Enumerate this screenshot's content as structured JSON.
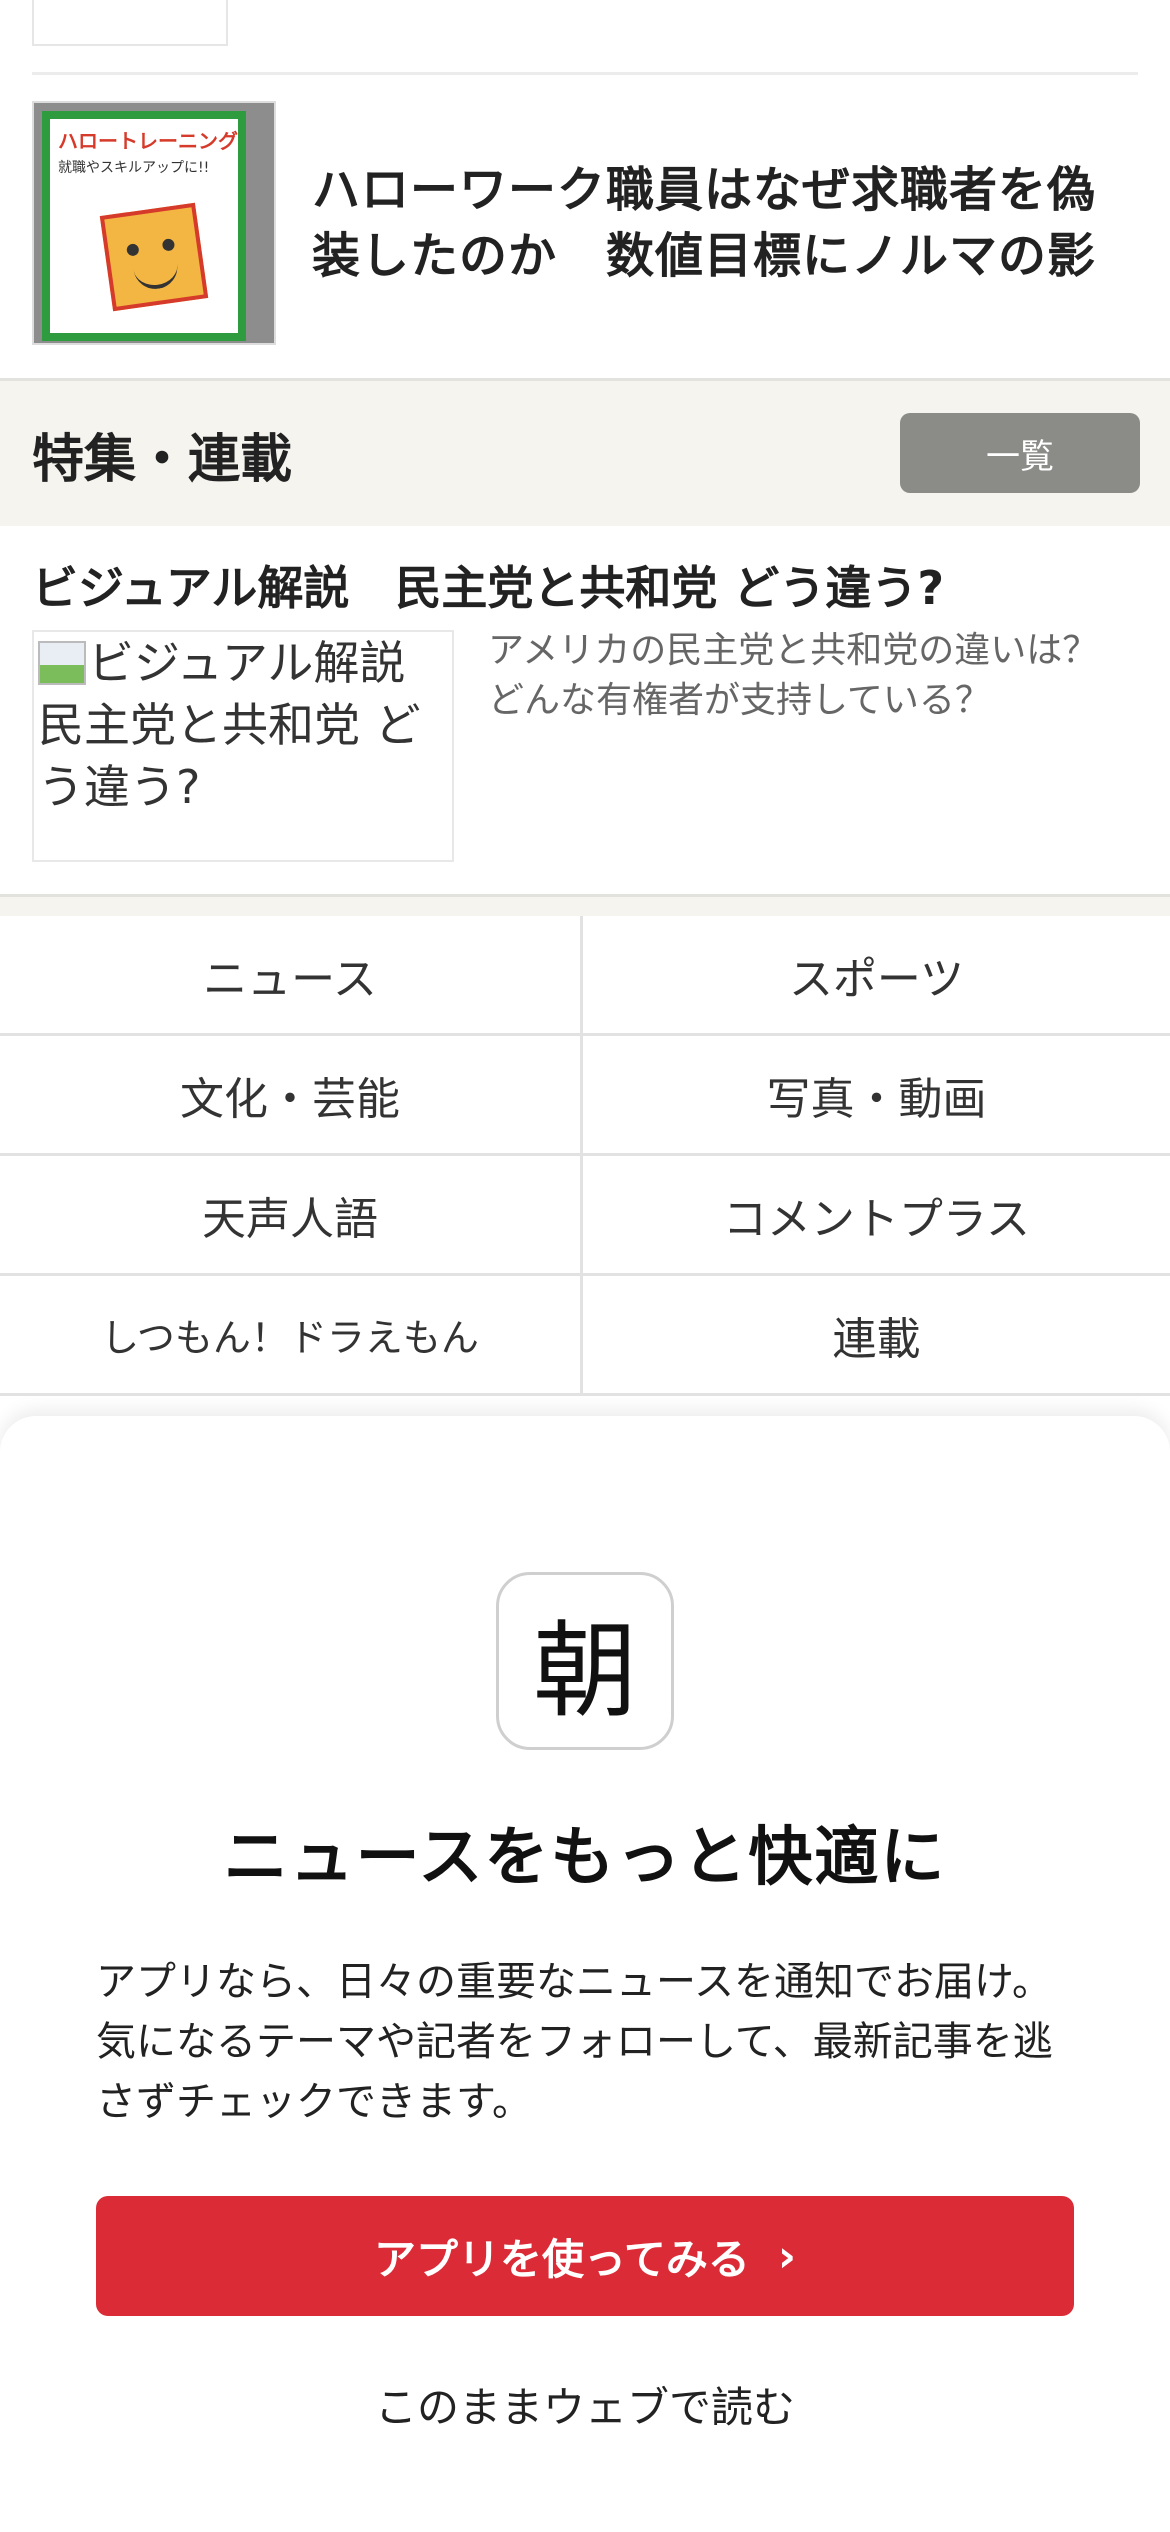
{
  "article": {
    "title": "ハローワーク職員はなぜ求職者を偽装したのか　数値目標にノルマの影",
    "thumb_poster_title": "ハロートレーニング",
    "thumb_poster_sub": "就職やスキルアップに!!"
  },
  "feature": {
    "heading": "特集・連載",
    "list_button": "一覧",
    "item_title": "ビジュアル解説　民主党と共和党 どう違う?",
    "image_alt": "ビジュアル解説　民主党と共和党 どう違う?",
    "item_desc": "アメリカの民主党と共和党の違いは？どんな有権者が支持している？"
  },
  "nav": {
    "items": [
      {
        "label": "ニュース"
      },
      {
        "label": "スポーツ"
      },
      {
        "label": "文化・芸能"
      },
      {
        "label": "写真・動画"
      },
      {
        "label": "天声人語"
      },
      {
        "label": "コメントプラス"
      },
      {
        "label": "しつもん！ドラえもん"
      },
      {
        "label": "連載"
      }
    ]
  },
  "sheet": {
    "app_icon_char": "朝",
    "title": "ニュースをもっと快適に",
    "description": "アプリなら、日々の重要なニュースを通知でお届け。気になるテーマや記者をフォローして、最新記事を逃さずチェックできます。",
    "cta_label": "アプリを使ってみる",
    "cta_chevron": "›",
    "web_link": "このままウェブで読む"
  },
  "colors": {
    "cta": "#db2b36",
    "band": "#f5f4ef",
    "list_button": "#8b8b87"
  }
}
